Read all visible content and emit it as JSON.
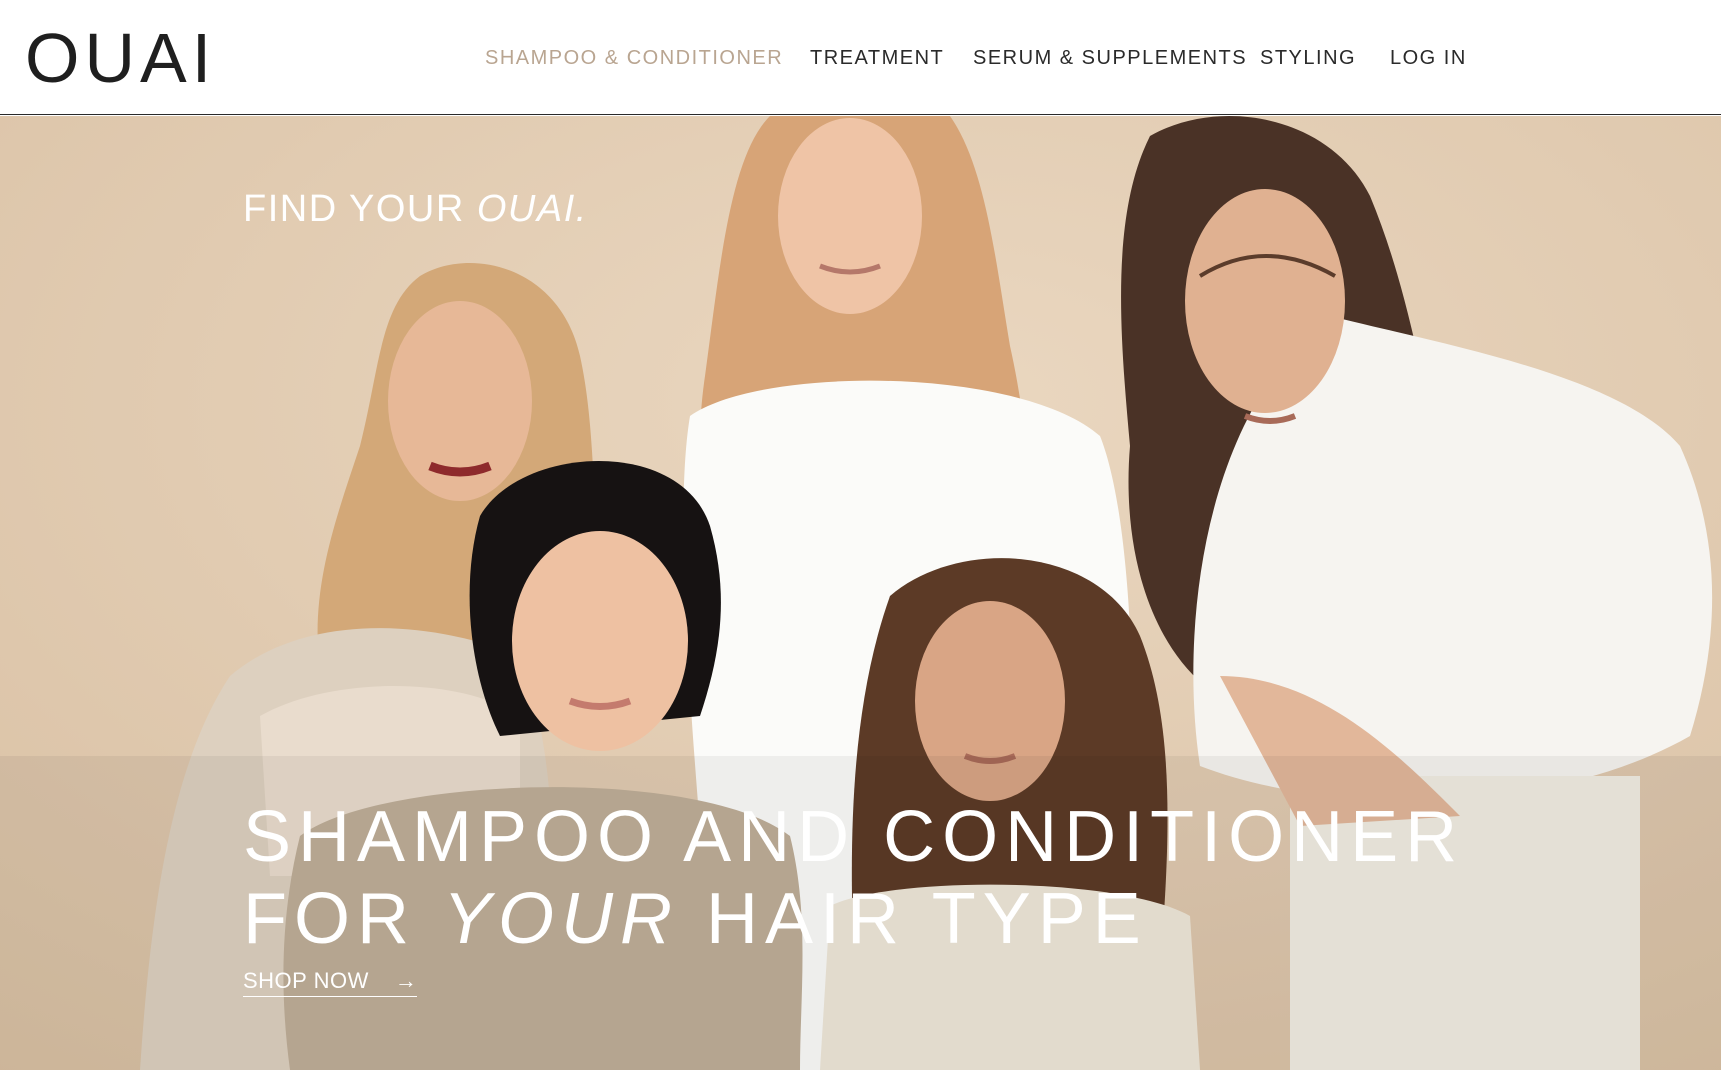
{
  "brand": {
    "logo_text": "OUAI"
  },
  "nav": {
    "items": [
      {
        "label": "SHAMPOO & CONDITIONER",
        "active": true
      },
      {
        "label": "TREATMENT",
        "active": false
      },
      {
        "label": "SERUM & SUPPLEMENTS",
        "active": false
      },
      {
        "label": "STYLING",
        "active": false
      },
      {
        "label": "LOG IN",
        "active": false
      }
    ]
  },
  "hero": {
    "kicker_plain": "FIND YOUR ",
    "kicker_italic": "OUAI.",
    "headline_line1": "SHAMPOO AND CONDITIONER",
    "headline_line2_start": "FOR ",
    "headline_line2_italic": "YOUR",
    "headline_line2_end": " HAIR TYPE",
    "cta_label": "SHOP NOW",
    "cta_icon": "arrow-right-icon"
  },
  "colors": {
    "active_nav": "#b9a591",
    "text_dark": "#2a2a2a",
    "hero_background": "#e2ccb2"
  }
}
